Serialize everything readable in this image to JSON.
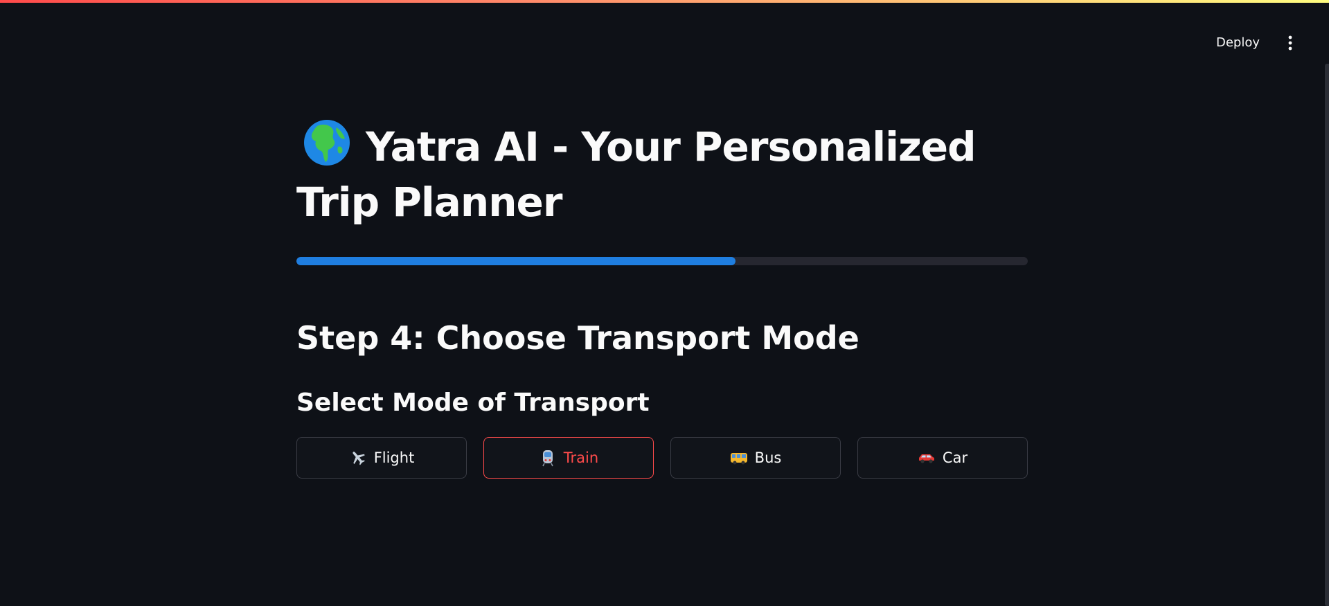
{
  "app": {
    "header": {
      "deploy_label": "Deploy",
      "menu_icon": "vertical-ellipsis-icon"
    },
    "theme": {
      "background": "#0e1117",
      "text": "#fafafa",
      "accent": "#ff4b4b",
      "progress_color": "#1f7ee0",
      "progress_track": "#262730"
    }
  },
  "page": {
    "title_icon": "globe-icon",
    "title": "Yatra AI - Your Personalized Trip Planner",
    "progress_percent": 60,
    "step_heading": "Step 4: Choose Transport Mode",
    "sub_heading": "Select Mode of Transport",
    "transport_options": [
      {
        "label": "Flight",
        "icon": "airplane-icon",
        "selected": false
      },
      {
        "label": "Train",
        "icon": "train-icon",
        "selected": true
      },
      {
        "label": "Bus",
        "icon": "bus-icon",
        "selected": false
      },
      {
        "label": "Car",
        "icon": "car-icon",
        "selected": false
      }
    ]
  }
}
